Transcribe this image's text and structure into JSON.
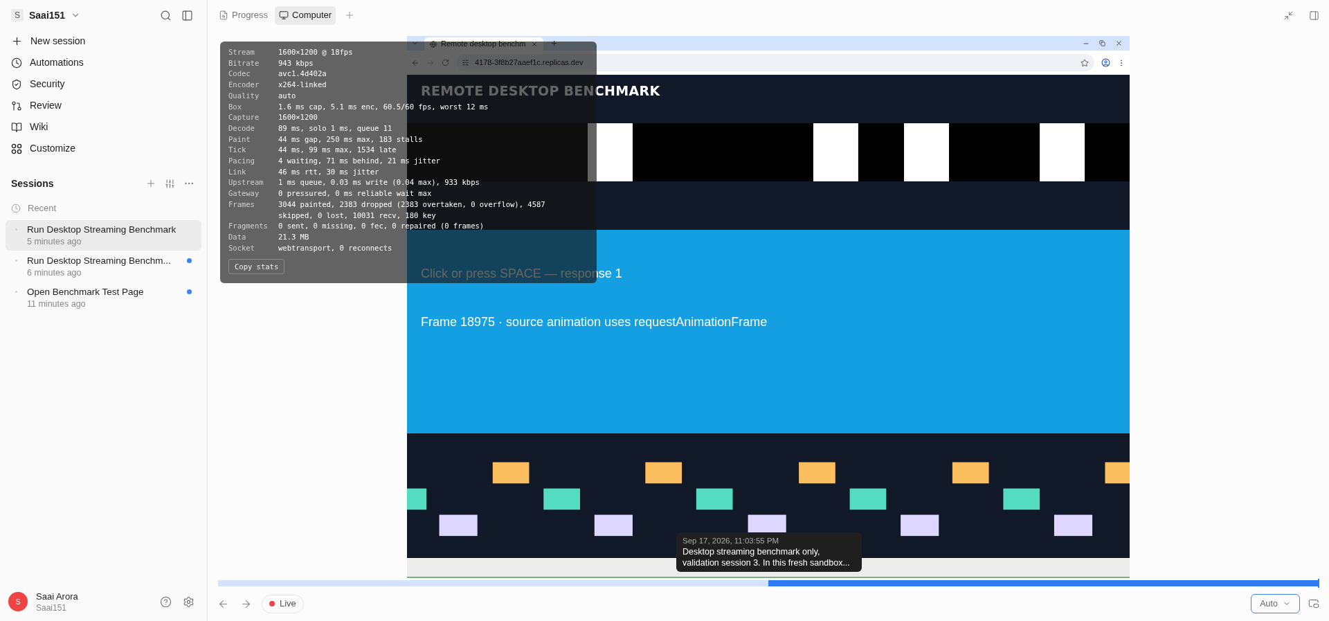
{
  "workspace": {
    "initial": "S",
    "name": "Saai151"
  },
  "nav": [
    {
      "label": "New session"
    },
    {
      "label": "Automations"
    },
    {
      "label": "Security"
    },
    {
      "label": "Review"
    },
    {
      "label": "Wiki"
    },
    {
      "label": "Customize"
    }
  ],
  "sessions": {
    "title": "Sessions",
    "group": "Recent",
    "items": [
      {
        "title": "Run Desktop Streaming Benchmark",
        "time": "5 minutes ago",
        "selected": true,
        "unread": false
      },
      {
        "title": "Run Desktop Streaming Benchm...",
        "time": "6 minutes ago",
        "selected": false,
        "unread": true
      },
      {
        "title": "Open Benchmark Test Page",
        "time": "11 minutes ago",
        "selected": false,
        "unread": true
      }
    ]
  },
  "user": {
    "initial": "S",
    "name": "Saai Arora",
    "handle": "Saai151"
  },
  "tabs": [
    {
      "label": "Progress",
      "selected": false
    },
    {
      "label": "Computer",
      "selected": true
    }
  ],
  "remote": {
    "browser_tab": "Remote desktop benchm",
    "url": "4178-3f8b27aaef1c.replicas.dev",
    "heading": "REMOTE DESKTOP BENCHMARK",
    "prompt": "Click or press SPACE — response 1",
    "frame_info": "Frame 18975 · source animation uses requestAnimationFrame"
  },
  "stats": {
    "rows": [
      {
        "label": "Stream",
        "value": "1600×1200 @ 18fps"
      },
      {
        "label": "Bitrate",
        "value": "943 kbps"
      },
      {
        "label": "Codec",
        "value": "avc1.4d402a"
      },
      {
        "label": "Encoder",
        "value": "x264-linked"
      },
      {
        "label": "Quality",
        "value": "auto"
      },
      {
        "label": "Box",
        "value": "1.6 ms cap, 5.1 ms enc, 60.5/60 fps, worst 12 ms"
      },
      {
        "label": "Capture",
        "value": "1600×1200"
      },
      {
        "label": "Decode",
        "value": "89 ms, solo 1 ms, queue 11"
      },
      {
        "label": "Paint",
        "value": "44 ms gap, 250 ms max, 183 stalls"
      },
      {
        "label": "Tick",
        "value": "44 ms, 99 ms max, 1534 late"
      },
      {
        "label": "Pacing",
        "value": "4 waiting, 71 ms behind, 21 ms jitter"
      },
      {
        "label": "Link",
        "value": "46 ms rtt, 30 ms jitter"
      },
      {
        "label": "Upstream",
        "value": "1 ms queue, 0.03 ms write (0.04 max), 933 kbps"
      },
      {
        "label": "Gateway",
        "value": "0 pressured, 0 ms reliable wait max"
      },
      {
        "label": "Frames",
        "value": "3044 painted, 2383 dropped (2383 overtaken, 0 overflow), 4587 skipped, 0 lost, 10031 recv, 180 key"
      },
      {
        "label": "Fragments",
        "value": "0 sent, 0 missing, 0 fec, 0 repaired (0 frames)"
      },
      {
        "label": "Data",
        "value": "21.3 MB"
      },
      {
        "label": "Socket",
        "value": "webtransport, 0 reconnects"
      }
    ],
    "copy_button": "Copy stats"
  },
  "tooltip": {
    "time": "Sep 17, 2026, 11:03:55 PM",
    "text": "Desktop streaming benchmark only, validation session 3. In this fresh sandbox..."
  },
  "timeline": {
    "level": 0.5
  },
  "controls": {
    "live": "Live",
    "quality": "Auto"
  }
}
